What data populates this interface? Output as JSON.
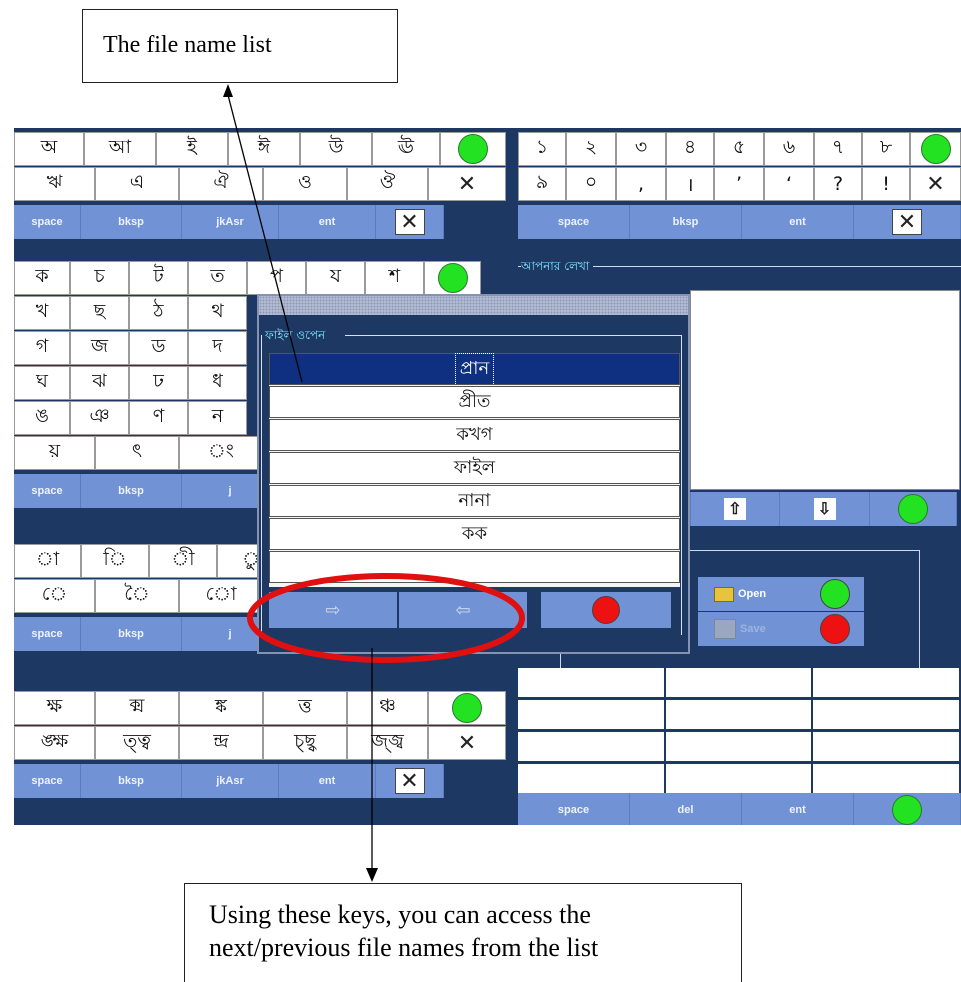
{
  "callouts": {
    "top": "The file name list",
    "bottom_line1": "Using these keys, you can access the",
    "bottom_line2": "next/previous file names from the list"
  },
  "vowels_keyboard": {
    "row1": [
      "অ",
      "আ",
      "ই",
      "ঈ",
      "উ",
      "ঊ"
    ],
    "row2": [
      "ঋ",
      "এ",
      "ঐ",
      "ও",
      "ঔ"
    ],
    "func": [
      "space",
      "bksp",
      "jkAsr",
      "ent"
    ]
  },
  "numbers_keyboard": {
    "row1": [
      "১",
      "২",
      "৩",
      "৪",
      "৫",
      "৬",
      "৭",
      "৮"
    ],
    "row2": [
      "৯",
      "০",
      ",",
      "।",
      "’",
      "‘",
      "?",
      "!"
    ],
    "func": [
      "space",
      "bksp",
      "ent"
    ]
  },
  "consonants_keyboard": {
    "row1": [
      "ক",
      "চ",
      "ট",
      "ত",
      "প",
      "য",
      "শ"
    ],
    "row2": [
      "খ",
      "ছ",
      "ঠ",
      "থ"
    ],
    "row3": [
      "গ",
      "জ",
      "ড",
      "দ"
    ],
    "row4": [
      "ঘ",
      "ঝ",
      "ঢ",
      "ধ"
    ],
    "row5": [
      "ঙ",
      "ঞ",
      "ণ",
      "ন"
    ],
    "row6": [
      "য়",
      "ৎ",
      "ং"
    ],
    "func": [
      "space",
      "bksp",
      "j"
    ]
  },
  "kar_keyboard": {
    "row1": [
      "া",
      "ি",
      "ী",
      "ু"
    ],
    "row2": [
      "ে",
      "ৈ",
      "ো"
    ],
    "func": [
      "space",
      "bksp",
      "j"
    ]
  },
  "conjunct_keyboard": {
    "row1": [
      "ক্ষ",
      "ক্ম",
      "ঙ্ক",
      "ত্ত",
      "ঞ্চ"
    ],
    "row2": [
      "ঙ্ক্ষ",
      "ত্ত্ব",
      "ন্দ্র",
      "চ্ছ্ব",
      "জ্জ্ব"
    ],
    "func": [
      "space",
      "bksp",
      "jkAsr",
      "ent"
    ]
  },
  "writing_panel": {
    "label": "আপনার লেখা"
  },
  "scroll_icons": {
    "up": "up-arrow-icon",
    "down": "down-arrow-icon"
  },
  "file_buttons": {
    "open": "Open",
    "save": "Save"
  },
  "bottom_bar": [
    "space",
    "del",
    "ent"
  ],
  "dialog": {
    "group_label": "ফাইল ওপেন",
    "files": [
      "প্রান",
      "প্রীত",
      "কখগ",
      "ফাইল",
      "নানা",
      "কক",
      ""
    ],
    "selected_index": 0,
    "next_icon": "right-arrow-icon",
    "prev_icon": "left-arrow-icon"
  },
  "colors": {
    "background": "#1e3864",
    "function_key": "#7193d6",
    "selection": "#0f2f80",
    "green": "#22e222",
    "red": "#ee1111",
    "highlight_ring": "#e01010",
    "panel_label": "#7fe7ff"
  }
}
